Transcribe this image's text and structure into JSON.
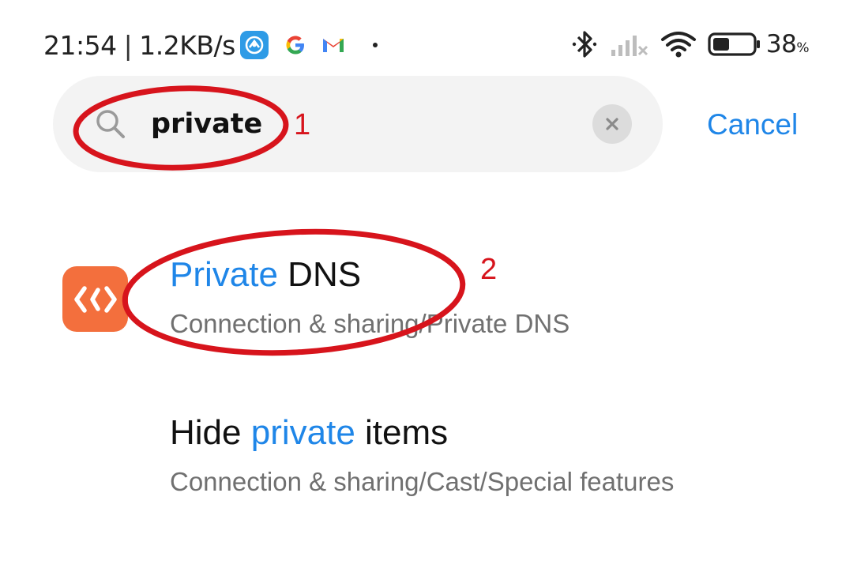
{
  "status_bar": {
    "time": "21:54",
    "separator": "|",
    "net_speed": "1.2KB/s",
    "notification_icons": [
      "browser-icon",
      "google-icon",
      "gmail-icon"
    ],
    "battery_level": "38",
    "battery_unit": "%",
    "status_icons": [
      "bluetooth-icon",
      "cellular-signal-off-icon",
      "wifi-icon",
      "battery-icon"
    ]
  },
  "search": {
    "query": "private",
    "cancel_label": "Cancel"
  },
  "results": [
    {
      "title_highlight": "Private",
      "title_rest": " DNS",
      "path": "Connection & sharing/Private DNS",
      "icon": "connection-sharing-icon"
    },
    {
      "title_before": "Hide ",
      "title_highlight": "private",
      "title_after": " items",
      "path": "Connection & sharing/Cast/Special features"
    }
  ],
  "annotations": {
    "step1": "1",
    "step2": "2"
  },
  "colors": {
    "accent": "#1f86e8",
    "annotation": "#d7141c",
    "result_icon_bg": "#f36f3d",
    "search_bg": "#f3f3f3"
  }
}
